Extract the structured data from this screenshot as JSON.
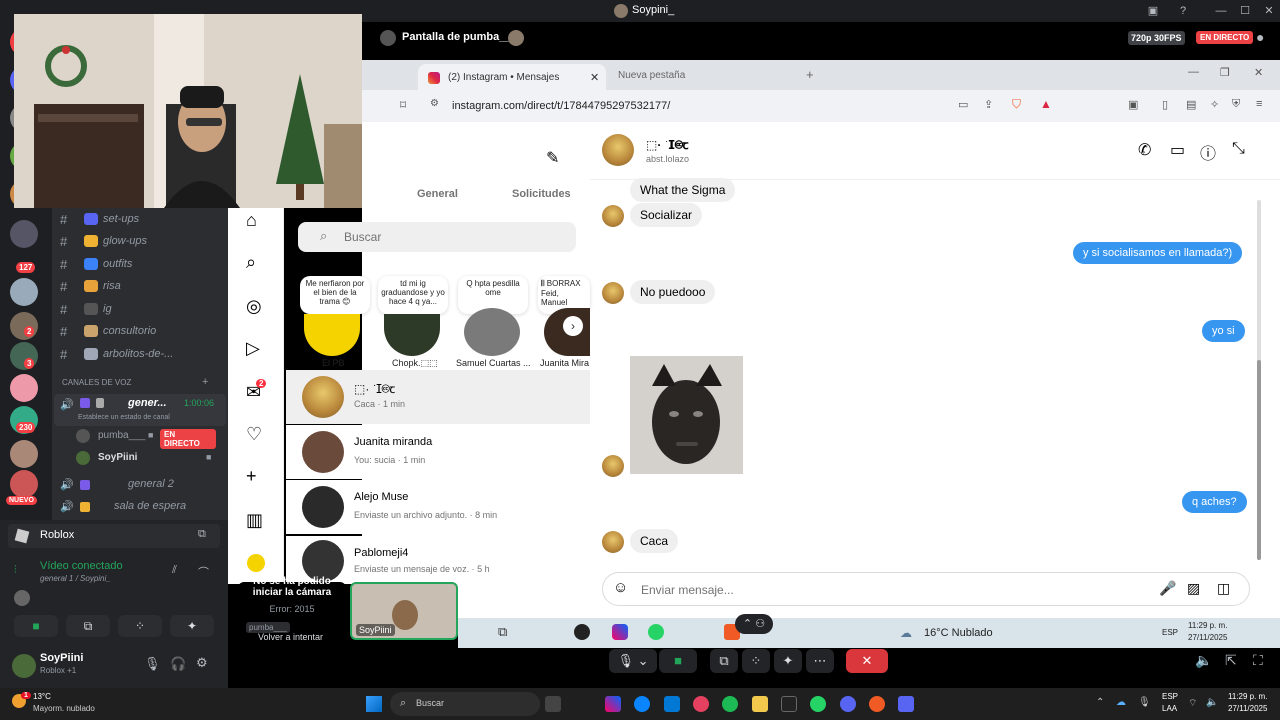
{
  "window": {
    "title": "Soypini_"
  },
  "stream": {
    "header": "Pantalla de pumba___",
    "quality": "720p 30FPS",
    "live_badge": "EN DIRECTO"
  },
  "browser": {
    "tab_active": "(2) Instagram • Mensajes",
    "tab_new": "Nueva pestaña",
    "url": "instagram.com/direct/t/17844795297532177/"
  },
  "instagram": {
    "tabs": {
      "general": "General",
      "requests": "Solicitudes"
    },
    "search_placeholder": "Buscar",
    "notes": [
      {
        "text": "Me nerfiaron por el bien de la trama 😊",
        "name": "El PB"
      },
      {
        "text": "td mi ig graduandose y yo hace 4 q ya...",
        "name": "Chopk.⬚⬚"
      },
      {
        "text": "Q hpta pesdilla ome",
        "name": "Samuel Cuartas ..."
      },
      {
        "text": "𝄃𝄃 BORRAX Feid, Manuel",
        "name": "Juanita Mira"
      }
    ],
    "notif_badge": "2",
    "conversations": [
      {
        "name": "⬚· ͘ ⵊ🅭ꞇ",
        "preview": "Caca · 1 min"
      },
      {
        "name": "Juanita miranda",
        "preview": "You: sucia · 1 min"
      },
      {
        "name": "Alejo Muse",
        "preview": "Enviaste un archivo adjunto. · 8 min"
      },
      {
        "name": "Pablomeji4",
        "preview": "Enviaste un mensaje de voz. · 5 h"
      }
    ],
    "chat": {
      "name": "⬚· ͘ ⵊ🅭ꞇ",
      "username": "abst.lolazo",
      "messages": {
        "m1": "What the Sigma",
        "m2": "Socializar",
        "m3": "y si socialisamos en llamada?)",
        "m4": "No puedooo",
        "m5": "yo si",
        "m6": "q aches?",
        "m7": "Caca"
      },
      "composer_placeholder": "Enviar mensaje..."
    }
  },
  "discord": {
    "channels": [
      {
        "name": "set-ups",
        "color": "#5865f2"
      },
      {
        "name": "glow-ups",
        "color": "#f0b232"
      },
      {
        "name": "outfits",
        "color": "#3b82f6"
      },
      {
        "name": "risa",
        "color": "#e8a23a"
      },
      {
        "name": "ig",
        "color": "#444"
      },
      {
        "name": "consultorio",
        "color": "#c9a36b"
      },
      {
        "name": "arbolitos-de-...",
        "color": "#a0a8b8"
      }
    ],
    "voice_header": "CANALES DE VOZ",
    "voice_channel": {
      "name": "gener...",
      "timer": "1:00:06",
      "status": "Establece un estado de canal"
    },
    "voice_users": [
      {
        "name": "pumba___",
        "badge": "EN DIRECTO"
      },
      {
        "name": "SoyPiini"
      }
    ],
    "voice_channel2": "general 2",
    "voice_channel3": "sala de espera",
    "activity": "Roblox",
    "connection": {
      "title": "Vídeo conectado",
      "detail": "general 1 / Soypini_"
    },
    "user": {
      "name": "SoyPiini",
      "status": "Roblox +1"
    },
    "server_badges": {
      "b1": "127",
      "b2": "2",
      "b3": "3",
      "b4": "230",
      "new": "NUEVO"
    },
    "camera_error": {
      "title": "No se ha podido iniciar la cámara",
      "code": "Error: 2015",
      "retry": "Volver a intentar",
      "tile_name": "pumba___"
    },
    "self_tile": "SoyPiini"
  },
  "stream_taskbar": {
    "weather": "16°C Nublado",
    "lang": "ESP",
    "time": "11:29 p. m.",
    "date": "27/11/2025"
  },
  "taskbar": {
    "weather_temp": "13°C",
    "weather_desc": "Mayorm. nublado",
    "search": "Buscar",
    "lang_top": "ESP",
    "lang_bottom": "LAA",
    "time": "11:29 p. m.",
    "date": "27/11/2025",
    "weather_badge": "1"
  },
  "colors": {
    "ig_blue": "#3797f0",
    "discord_red": "#f23f43",
    "discord_green": "#23a55a",
    "live_red": "#ed4245"
  }
}
